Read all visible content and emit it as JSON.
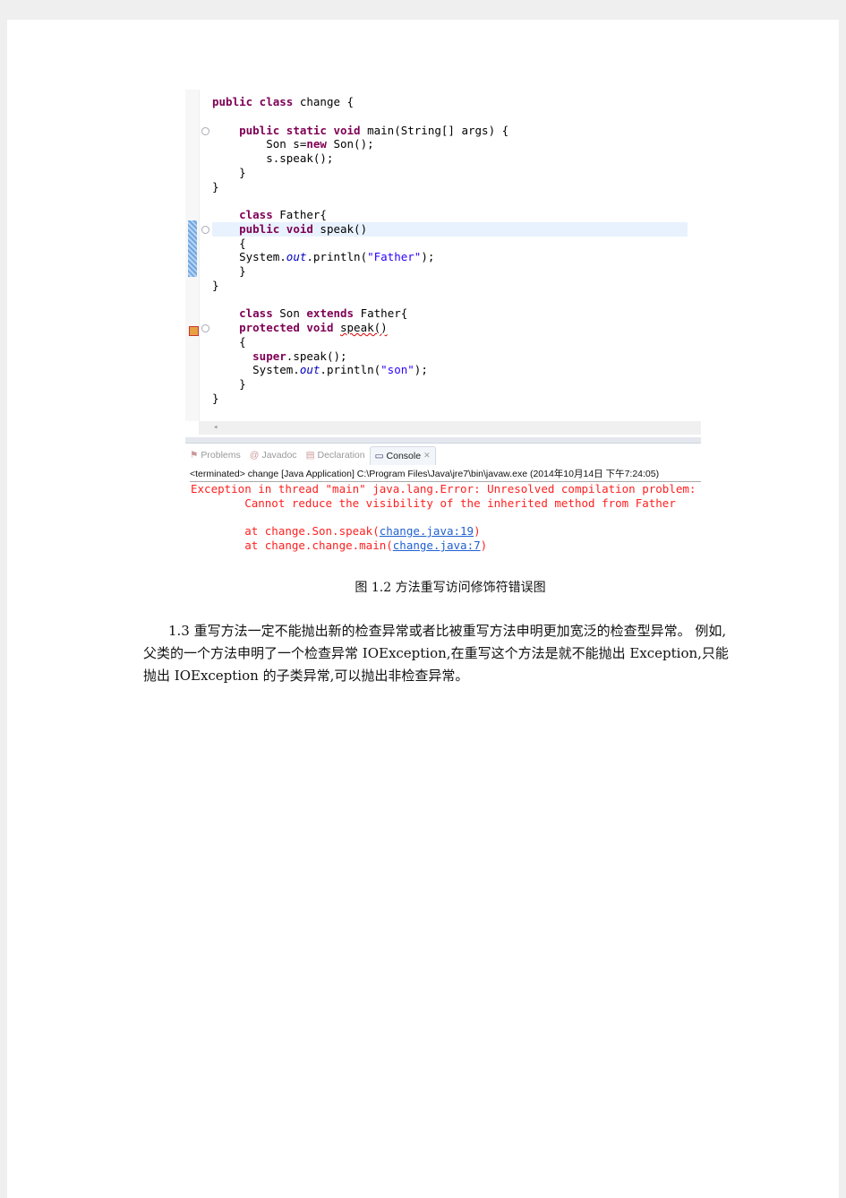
{
  "code_lines": [
    [
      [
        "k",
        "public class"
      ],
      [
        "t",
        " change {"
      ]
    ],
    [],
    [
      [
        "t",
        "    "
      ],
      [
        "k",
        "public static void"
      ],
      [
        "t",
        " main(String[] args) {"
      ]
    ],
    [
      [
        "t",
        "        Son s="
      ],
      [
        "k",
        "new"
      ],
      [
        "t",
        " Son();"
      ]
    ],
    [
      [
        "t",
        "        s.speak();"
      ]
    ],
    [
      [
        "t",
        "    }"
      ]
    ],
    [
      [
        "t",
        "}"
      ]
    ],
    [],
    [
      [
        "t",
        "    "
      ],
      [
        "k",
        "class"
      ],
      [
        "t",
        " Father{"
      ]
    ],
    [
      [
        "t",
        "    "
      ],
      [
        "k",
        "public void"
      ],
      [
        "t",
        " speak()"
      ]
    ],
    [
      [
        "t",
        "    {"
      ]
    ],
    [
      [
        "t",
        "    System."
      ],
      [
        "f",
        "out"
      ],
      [
        "t",
        ".println("
      ],
      [
        "s",
        "\"Father\""
      ],
      [
        "t",
        ");"
      ]
    ],
    [
      [
        "t",
        "    }"
      ]
    ],
    [
      [
        "t",
        "}"
      ]
    ],
    [],
    [
      [
        "t",
        "    "
      ],
      [
        "k",
        "class"
      ],
      [
        "t",
        " Son "
      ],
      [
        "k",
        "extends"
      ],
      [
        "t",
        " Father{"
      ]
    ],
    [
      [
        "t",
        "    "
      ],
      [
        "k",
        "protected void"
      ],
      [
        "t",
        " "
      ],
      [
        "u",
        "speak()"
      ]
    ],
    [
      [
        "t",
        "    {"
      ]
    ],
    [
      [
        "t",
        "      "
      ],
      [
        "k",
        "super"
      ],
      [
        "t",
        ".speak();"
      ]
    ],
    [
      [
        "t",
        "      System."
      ],
      [
        "f",
        "out"
      ],
      [
        "t",
        ".println("
      ],
      [
        "s",
        "\"son\""
      ],
      [
        "t",
        ");"
      ]
    ],
    [
      [
        "t",
        "    }"
      ]
    ],
    [
      [
        "t",
        "}"
      ]
    ]
  ],
  "tabs": [
    {
      "label": "Problems",
      "icon": "problems-icon"
    },
    {
      "label": "Javadoc",
      "icon": "at-icon"
    },
    {
      "label": "Declaration",
      "icon": "declaration-icon"
    },
    {
      "label": "Console",
      "icon": "console-icon",
      "active": true
    }
  ],
  "console_header": "<terminated> change [Java Application] C:\\Program Files\\Java\\jre7\\bin\\javaw.exe (2014年10月14日 下午7:24:05)",
  "console": {
    "line1": "Exception in thread \"main\" java.lang.Error: Unresolved compilation problem: ",
    "line2": "        Cannot reduce the visibility of the inherited method from Father",
    "at1_prefix": "        at change.Son.speak(",
    "at1_link": "change.java:19",
    "at2_prefix": "        at change.change.main(",
    "at2_link": "change.java:7",
    "close": ")"
  },
  "caption": "图 1.2 方法重写访问修饰符错误图",
  "paragraph": "1.3 重写方法一定不能抛出新的检查异常或者比被重写方法申明更加宽泛的检查型异常。 例如,父类的一个方法申明了一个检查异常 IOException,在重写这个方法是就不能抛出 Exception,只能抛出 IOException 的子类异常,可以抛出非检查异常。",
  "colors": {
    "keyword": "#7f0055",
    "string": "#2a00ff",
    "field": "#0000c0",
    "error": "#ff2020",
    "link": "#2060d0"
  }
}
